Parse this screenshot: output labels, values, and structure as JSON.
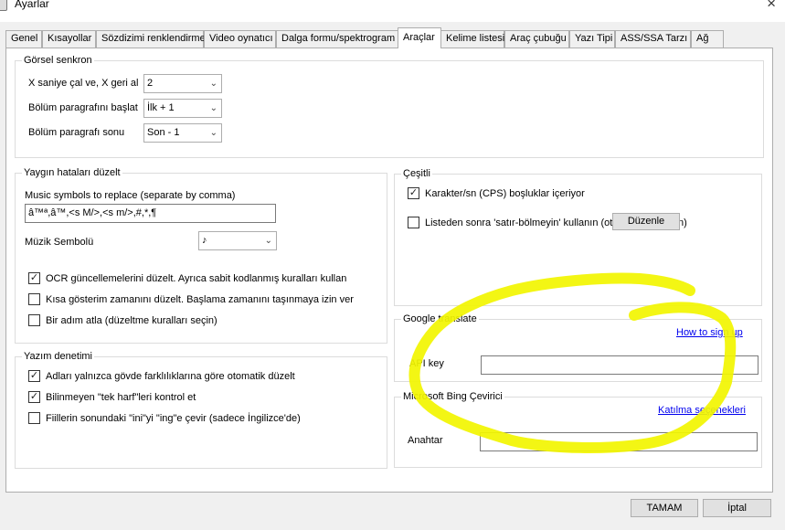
{
  "window": {
    "title": "Ayarlar",
    "close_glyph": "×"
  },
  "tabs": [
    "Genel",
    "Kısayollar",
    "Sözdizimi renklendirme",
    "Video oynatıcı",
    "Dalga formu/spektrogram",
    "Araçlar",
    "Kelime listesi",
    "Araç çubuğu",
    "Yazı Tipi",
    "ASS/SSA Tarzı",
    "Ağ"
  ],
  "active_tab": "Araçlar",
  "visual_sync": {
    "title": "Görsel senkron",
    "rows": [
      {
        "label": "X saniye çal ve, X geri al",
        "value": "2"
      },
      {
        "label": "Bölüm paragrafını başlat",
        "value": "İlk + 1"
      },
      {
        "label": "Bölüm paragrafı sonu",
        "value": "Son - 1"
      }
    ]
  },
  "fix_errors": {
    "title": "Yaygın hataları düzelt",
    "music_label": "Music symbols to replace (separate by comma)",
    "music_value": "â™ª,â™,<s M/>,<s m/>,#,*,¶",
    "music_symbol_label": "Müzik Sembolü",
    "music_symbol_value": "♪",
    "checks": [
      {
        "label": "OCR güncellemelerini düzelt. Ayrıca sabit kodlanmış kuralları kullan",
        "checked": true
      },
      {
        "label": "Kısa gösterim zamanını düzelt. Başlama zamanını taşınmaya izin ver",
        "checked": false
      },
      {
        "label": "Bir adım atla (düzeltme kuralları seçin)",
        "checked": false
      }
    ]
  },
  "spell_check": {
    "title": "Yazım denetimi",
    "checks": [
      {
        "label": "Adları yalnızca gövde farklılıklarına göre otomatik düzelt",
        "checked": true
      },
      {
        "label": "Bilinmeyen \"tek harf\"leri kontrol et",
        "checked": true
      },
      {
        "label": "Fiillerin sonundaki \"ini\"yi \"ing\"e çevir (sadece İngilizce'de)",
        "checked": false
      }
    ]
  },
  "misc": {
    "title": "Çeşitli",
    "cps_label": "Karakter/sn (CPS) boşluklar içeriyor",
    "cps_checked": true,
    "continue_label": "Listeden sonra 'satır-bölmeyin' kullanın (oto",
    "continue_suffix": "n)",
    "continue_checked": false,
    "edit_button": "Düzenle"
  },
  "google": {
    "title": "Google translate",
    "signup_link": "How to sign up",
    "api_key_label": "API key",
    "api_key_value": ""
  },
  "bing": {
    "title": "Microsoft Bing Çevirici",
    "join_link": "Katılma seçenekleri",
    "key_label": "Anahtar",
    "key_value": ""
  },
  "footer": {
    "ok": "TAMAM",
    "cancel": "İptal"
  },
  "colors": {
    "highlight": "#f2f500",
    "link": "#0000ee",
    "panel_border": "#dcdcdc"
  }
}
